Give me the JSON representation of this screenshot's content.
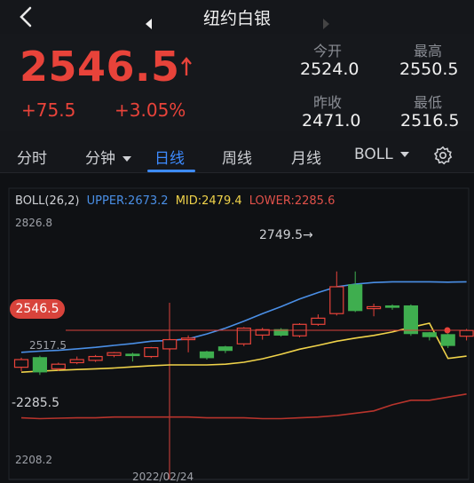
{
  "header": {
    "title": "纽约白银",
    "back_icon": "chevron-left-icon"
  },
  "quote": {
    "price": "2546.5",
    "change": "+75.5",
    "change_pct": "+3.05%",
    "open_label": "今开",
    "open_value": "2524.0",
    "high_label": "最高",
    "high_value": "2550.5",
    "prev_close_label": "昨收",
    "prev_close_value": "2471.0",
    "low_label": "最低",
    "low_value": "2516.5",
    "up_color": "#e8433a"
  },
  "tabs": [
    {
      "label": "分时"
    },
    {
      "label": "分钟"
    },
    {
      "label": "日线"
    },
    {
      "label": "周线"
    },
    {
      "label": "月线"
    },
    {
      "label": "BOLL"
    }
  ],
  "chart": {
    "indicator": "BOLL(26,2)",
    "upper_label": "UPPER:2673.2",
    "mid_label": "MID:2479.4",
    "lower_label": "LOWER:2285.6",
    "y_top": "2826.8",
    "y_mid": "2517.5",
    "y_lower": "-2285.5",
    "y_bottom": "2208.2",
    "high_marker": "2749.5→",
    "current_tag": "2546.5",
    "date": "2022/02/24",
    "colors": {
      "upper": "#4a8fe6",
      "mid": "#f0d34a",
      "lower": "#b8342c",
      "up": "#e8433a",
      "down": "#3fae4f"
    }
  },
  "chart_data": {
    "type": "candlestick",
    "ylim": [
      2208.2,
      2826.8
    ],
    "current_price": 2546.5,
    "high_marker": 2749.5,
    "candles": [
      {
        "o": 2450,
        "c": 2470,
        "h": 2475,
        "l": 2440
      },
      {
        "o": 2475,
        "c": 2438,
        "h": 2480,
        "l": 2430
      },
      {
        "o": 2446,
        "c": 2458,
        "h": 2462,
        "l": 2440
      },
      {
        "o": 2462,
        "c": 2470,
        "h": 2478,
        "l": 2458
      },
      {
        "o": 2468,
        "c": 2478,
        "h": 2482,
        "l": 2464
      },
      {
        "o": 2481,
        "c": 2488,
        "h": 2490,
        "l": 2476
      },
      {
        "o": 2484,
        "c": 2482,
        "h": 2488,
        "l": 2465
      },
      {
        "o": 2478,
        "c": 2501,
        "h": 2503,
        "l": 2474
      },
      {
        "o": 2498,
        "c": 2522,
        "h": 2525,
        "l": 2492
      },
      {
        "o": 2522,
        "c": 2526,
        "h": 2533,
        "l": 2489
      },
      {
        "o": 2490,
        "c": 2475,
        "h": 2493,
        "l": 2470
      },
      {
        "o": 2503,
        "c": 2494,
        "h": 2506,
        "l": 2487
      },
      {
        "o": 2511,
        "c": 2552,
        "h": 2555,
        "l": 2505
      },
      {
        "o": 2534,
        "c": 2548,
        "h": 2553,
        "l": 2522
      },
      {
        "o": 2548,
        "c": 2534,
        "h": 2552,
        "l": 2530
      },
      {
        "o": 2532,
        "c": 2562,
        "h": 2565,
        "l": 2528
      },
      {
        "o": 2562,
        "c": 2578,
        "h": 2588,
        "l": 2558
      },
      {
        "o": 2590,
        "c": 2660,
        "h": 2700,
        "l": 2585
      },
      {
        "o": 2665,
        "c": 2598,
        "h": 2700,
        "l": 2594
      },
      {
        "o": 2603,
        "c": 2608,
        "h": 2616,
        "l": 2583
      },
      {
        "o": 2610,
        "c": 2608,
        "h": 2614,
        "l": 2600
      },
      {
        "o": 2610,
        "c": 2538,
        "h": 2614,
        "l": 2532
      },
      {
        "o": 2540,
        "c": 2530,
        "h": 2542,
        "l": 2520
      },
      {
        "o": 2535,
        "c": 2507,
        "h": 2538,
        "l": 2500
      },
      {
        "o": 2531,
        "c": 2546,
        "h": 2550,
        "l": 2520
      }
    ],
    "upper": [
      2489,
      2492,
      2494,
      2498,
      2502,
      2507,
      2512,
      2518,
      2520,
      2524,
      2537,
      2552,
      2570,
      2590,
      2608,
      2628,
      2645,
      2660,
      2667,
      2671,
      2673,
      2673,
      2673,
      2672,
      2673
    ],
    "mid": [
      2437,
      2440,
      2442,
      2444,
      2446,
      2448,
      2451,
      2454,
      2456,
      2456,
      2456,
      2458,
      2463,
      2472,
      2484,
      2497,
      2507,
      2518,
      2526,
      2533,
      2542,
      2554,
      2565,
      2473,
      2479
    ],
    "lower": [
      2318,
      2316,
      2317,
      2318,
      2318,
      2320,
      2320,
      2320,
      2320,
      2320,
      2318,
      2318,
      2318,
      2316,
      2316,
      2318,
      2320,
      2324,
      2330,
      2336,
      2352,
      2364,
      2364,
      2372,
      2380
    ]
  }
}
